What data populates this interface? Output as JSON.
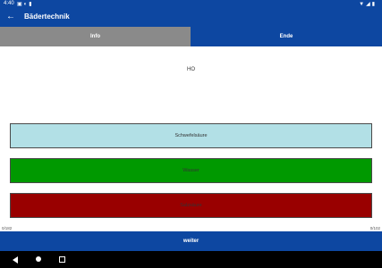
{
  "status_bar": {
    "time": "4:40",
    "left_icons": [
      "notification-icon",
      "notification-icon",
      "notification-icon"
    ],
    "right_icons": [
      "wifi-icon",
      "signal-icon",
      "battery-icon"
    ]
  },
  "app_bar": {
    "title": "Bädertechnik"
  },
  "tabs": [
    {
      "label": "Info"
    },
    {
      "label": "Ende"
    }
  ],
  "question": "HO",
  "answers": [
    {
      "label": "Schwefelsäure"
    },
    {
      "label": "Wasser"
    },
    {
      "label": "Salzsäure"
    }
  ],
  "counter": {
    "left": "0/182",
    "right": "0/102"
  },
  "next_label": "weiter",
  "colors": {
    "primary": "#0d47a1",
    "tab_inactive": "#8a8a8a",
    "answer_light": "#b2e0e6",
    "answer_correct": "#009900",
    "answer_wrong": "#990000"
  }
}
